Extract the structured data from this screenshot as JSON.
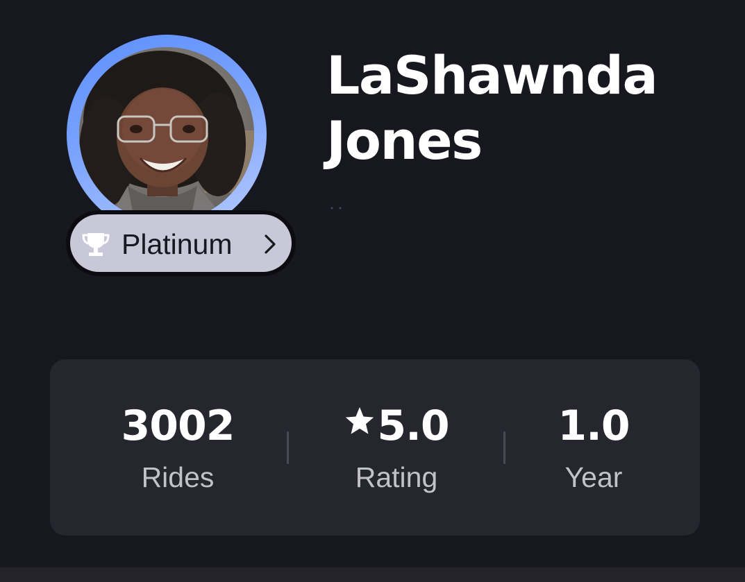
{
  "profile": {
    "name_line1": "LaShawnda",
    "name_line2": "Jones",
    "avatar_icon": "profile-photo",
    "tier": {
      "label": "Platinum",
      "icon": "trophy-icon",
      "chevron_icon": "chevron-right-icon"
    }
  },
  "stats": {
    "rides": {
      "value": "3002",
      "label": "Rides"
    },
    "rating": {
      "value": "5.0",
      "label": "Rating",
      "icon": "star-icon"
    },
    "years": {
      "value": "1.0",
      "label": "Year"
    }
  },
  "colors": {
    "background": "#171720",
    "card": "#26262f",
    "tier_badge": "#c8c8d8",
    "avatar_ring_start": "#5d8ffb",
    "avatar_ring_end": "#b8cbff",
    "text_primary": "#ffffff",
    "text_secondary": "#c2c2c9"
  }
}
